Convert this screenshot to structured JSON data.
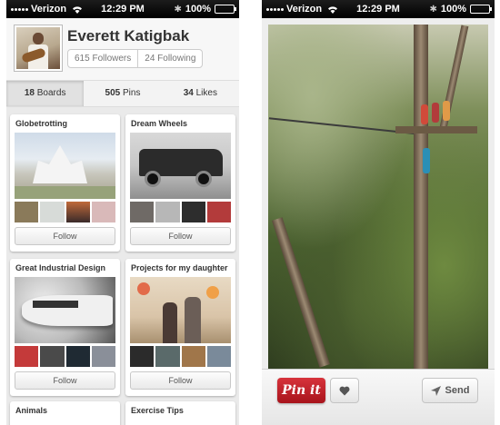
{
  "statusbar": {
    "carrier": "Verizon",
    "time": "12:29 PM",
    "battery": "100%"
  },
  "profile": {
    "name": "Everett Katigbak",
    "followers": "615 Followers",
    "following": "24 Following"
  },
  "tabs": [
    {
      "count": "18",
      "label": "Boards"
    },
    {
      "count": "505",
      "label": "Pins"
    },
    {
      "count": "34",
      "label": "Likes"
    }
  ],
  "boards": [
    {
      "title": "Globetrotting",
      "follow": "Follow"
    },
    {
      "title": "Dream Wheels",
      "follow": "Follow"
    },
    {
      "title": "Great Industrial Design",
      "follow": "Follow"
    },
    {
      "title": "Projects for my daughter",
      "follow": "Follow"
    },
    {
      "title": "Animals"
    },
    {
      "title": "Exercise Tips"
    }
  ],
  "pin_actions": {
    "pin_it": "Pin it",
    "send": "Send"
  },
  "colors": {
    "pin_red": "#c4161c",
    "status_bar": "#000000"
  },
  "icons": [
    "signal-icon",
    "wifi-icon",
    "bluetooth-icon",
    "battery-icon",
    "heart-icon",
    "send-arrow-icon"
  ]
}
